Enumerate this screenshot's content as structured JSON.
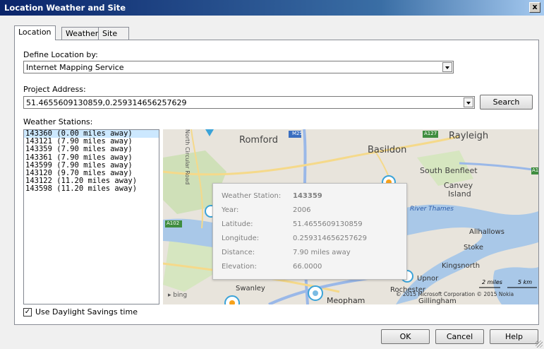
{
  "window": {
    "title": "Location Weather and Site",
    "close_glyph": "x"
  },
  "tabs": [
    {
      "label": "Location"
    },
    {
      "label": "Weather"
    },
    {
      "label": "Site"
    }
  ],
  "location": {
    "define_label": "Define Location by:",
    "define_value": "Internet Mapping Service",
    "address_label": "Project Address:",
    "address_value": "51.4655609130859,0.259314656257629",
    "search_label": "Search",
    "stations_label": "Weather Stations:",
    "stations": [
      "143360 (0.00 miles away)",
      "143121 (7.90 miles away)",
      "143359 (7.90 miles away)",
      "143361 (7.90 miles away)",
      "143599 (7.90 miles away)",
      "143120 (9.70 miles away)",
      "143122 (11.20 miles away)",
      "143598 (11.20 miles away)"
    ],
    "daylight_label": "Use Daylight Savings time"
  },
  "map": {
    "places": {
      "romford": "Romford",
      "basildon": "Basildon",
      "rayleigh": "Rayleigh",
      "south_benfleet": "South Benfleet",
      "canvey": "Canvey",
      "island": "Island",
      "river_thames": "River Thames",
      "allhallows": "Allhallows",
      "stoke": "Stoke",
      "kingsnorth": "Kingsnorth",
      "swanley": "Swanley",
      "meopham": "Meopham",
      "upnor": "Upnor",
      "rochester": "Rochester",
      "gillingham": "Gillingham",
      "north_circular": "North Circular Road"
    },
    "road_labels": {
      "m25": "M25",
      "a127": "A127",
      "a102": "A102",
      "a13": "A1"
    },
    "scale_miles": "2 miles",
    "scale_km": "5 km",
    "copyright": "© 2015 Microsoft Corporation   © 2015 Nokia",
    "bing": "bing",
    "popup": {
      "station_key": "Weather Station:",
      "station_val": "143359",
      "year_key": "Year:",
      "year_val": "2006",
      "lat_key": "Latitude:",
      "lat_val": "51.4655609130859",
      "lon_key": "Longitude:",
      "lon_val": "0.259314656257629",
      "dist_key": "Distance:",
      "dist_val": "7.90 miles away",
      "elev_key": "Elevation:",
      "elev_val": "66.0000"
    }
  },
  "buttons": {
    "ok": "OK",
    "cancel": "Cancel",
    "help": "Help"
  },
  "colors": {
    "title_bar": "#0a246a",
    "selection": "#cce8ff",
    "water": "#a9c8e8",
    "road": "#9ab8e8"
  }
}
